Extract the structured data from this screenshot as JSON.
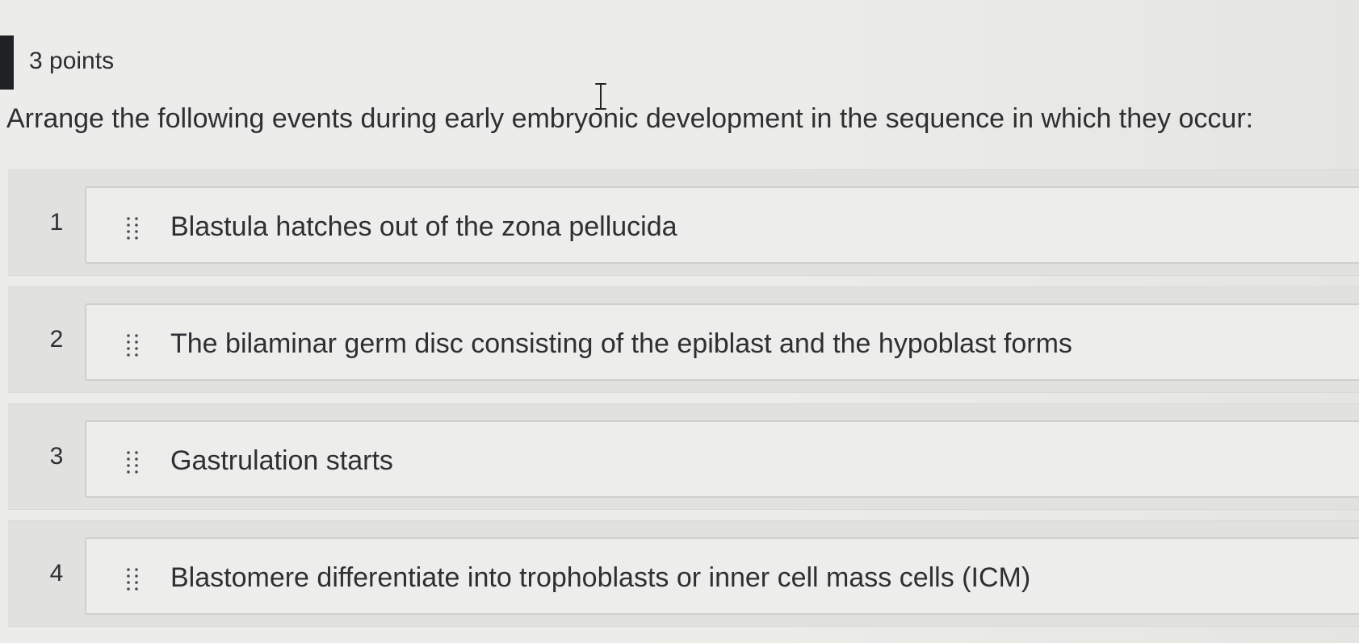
{
  "question": {
    "points": "3 points",
    "prompt": "Arrange the following events during early embryonic development in the sequence in which they occur:"
  },
  "ordering": {
    "items": [
      {
        "number": "1",
        "text": "Blastula hatches out of the zona pellucida"
      },
      {
        "number": "2",
        "text": "The bilaminar germ disc consisting of the epiblast and the hypoblast forms"
      },
      {
        "number": "3",
        "text": "Gastrulation starts"
      },
      {
        "number": "4",
        "text": "Blastomere differentiate into trophoblasts or inner cell mass cells (ICM)"
      }
    ]
  },
  "icons": {
    "drag_handle": "drag-handle-icon",
    "text_cursor": "text-cursor-icon"
  },
  "colors": {
    "background": "#e9e9e7",
    "row_background": "#e1e1df",
    "item_background": "#ededeb",
    "text": "#2d2f33",
    "marker": "#1f2124"
  }
}
